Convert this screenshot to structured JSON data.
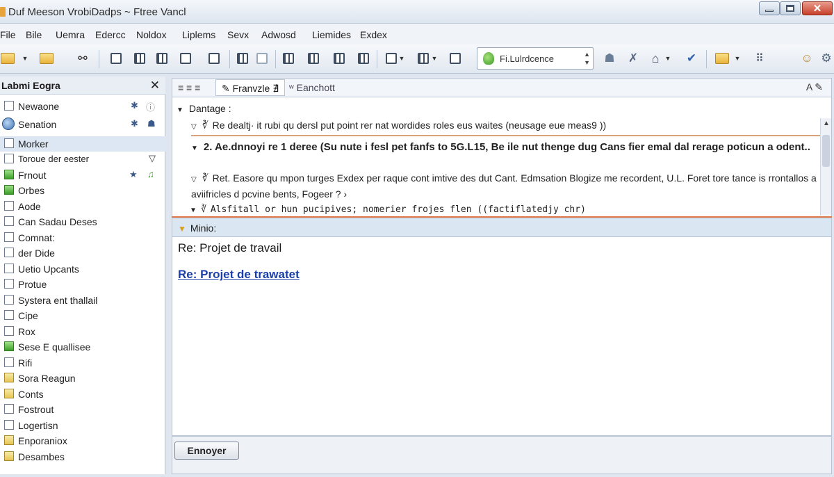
{
  "window": {
    "title": "Duf Meeson VrobiDadps ~ Ftree Vancl"
  },
  "menu": [
    "File",
    "Bile",
    "Uemra",
    "Edercc",
    "Noldox",
    "Liplems",
    "Sevx",
    "Adwosd",
    "Liemides",
    "Exdex"
  ],
  "toolbar": {
    "combo_value": "Fi.Lulrdcence"
  },
  "left": {
    "header": "Labmi Eogra",
    "close": "✕",
    "items": [
      {
        "label": "Newaone"
      },
      {
        "label": "Senation"
      },
      {
        "label": "Morker"
      },
      {
        "label": "Toroue der eester"
      },
      {
        "label": "Frnout"
      },
      {
        "label": "Orbes"
      },
      {
        "label": "Aode"
      },
      {
        "label": "Can Sadau Deses"
      },
      {
        "label": "Comnat:"
      },
      {
        "label": "der Dide"
      },
      {
        "label": "Uetio Upcants"
      },
      {
        "label": "Protue"
      },
      {
        "label": "Systera ent thallail"
      },
      {
        "label": "Cipe"
      },
      {
        "label": "Rox"
      },
      {
        "label": "Sese E quallisee"
      },
      {
        "label": "Rifi"
      },
      {
        "label": "Sora Reagun"
      },
      {
        "label": "Conts"
      },
      {
        "label": "Fostrout"
      },
      {
        "label": "Logertisn"
      },
      {
        "label": "Enporaniox"
      },
      {
        "label": "Desambes"
      }
    ]
  },
  "tabs": {
    "a": "≡ ≡ ≡",
    "b": "✎ Franvzle ∄",
    "c": "ʷ Eanchott",
    "tools": "A  ✎"
  },
  "list": {
    "group": "Dantage :",
    "messages": [
      "Re dealtj· it rubi qu dersl put point rer nat wordides roles eus waites (neusage eue meas9 ))",
      "2. Ae.dnnoyi re 1 deree (Su nute i fesl pet fanfs to 5G.L15, Be ile nut thenge dug  Cans fier emal dal rerage poticun a odent..",
      "Ret. Easore qu mpon turges Exdex per raque cont imtive des dut Cant. Edmsation Blogize me recordent, U.L. Foret tore tance is rrontallos a aviifricles d pcvine bents, Fogeer ? ›",
      "Alsfitall or hun pucipives; nomerier frojes flen ((factiflatedjy chr)"
    ]
  },
  "preview": {
    "header": "Minio:",
    "subject": "Re: Projet de travail",
    "link": "Re:  Projet de trawatet"
  },
  "footer": {
    "send": "Ennoyer"
  }
}
